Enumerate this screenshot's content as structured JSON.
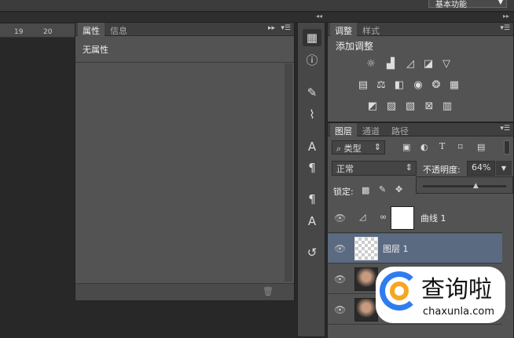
{
  "workspace": {
    "label": "基本功能"
  },
  "ruler": {
    "ticks": [
      "19",
      "20"
    ]
  },
  "properties_panel": {
    "tabs": [
      "属性",
      "信息"
    ],
    "content": "无属性"
  },
  "adjustments_panel": {
    "tabs": [
      "调整",
      "样式"
    ],
    "title": "添加调整",
    "icons": [
      [
        "brightness-icon",
        "levels-icon",
        "curves-icon",
        "exposure-icon",
        "vibrance-icon"
      ],
      [
        "hue-saturation-icon",
        "color-balance-icon",
        "black-white-icon",
        "photo-filter-icon",
        "channel-mixer-icon",
        "color-lookup-icon"
      ],
      [
        "invert-icon",
        "posterize-icon",
        "threshold-icon",
        "selective-color-icon",
        "gradient-map-icon"
      ]
    ]
  },
  "layers_panel": {
    "tabs": [
      "图层",
      "通道",
      "路径"
    ],
    "filter_kind": "类型",
    "blend_mode": "正常",
    "opacity_label": "不透明度:",
    "opacity_value": "64%",
    "opacity_fraction": 0.64,
    "lock_label": "锁定:",
    "layers": [
      {
        "name": "曲线 1",
        "type": "adjustment"
      },
      {
        "name": "图层 1",
        "type": "transparent",
        "selected": true
      },
      {
        "name": "",
        "type": "photo"
      },
      {
        "name": "",
        "type": "photo"
      }
    ]
  },
  "watermark": {
    "brand": "查询啦",
    "url": "chaxunla.com"
  }
}
